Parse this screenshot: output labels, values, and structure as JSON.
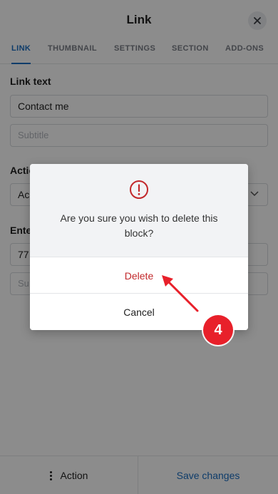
{
  "header": {
    "title": "Link"
  },
  "tabs": [
    {
      "label": "LINK"
    },
    {
      "label": "THUMBNAIL"
    },
    {
      "label": "SETTINGS"
    },
    {
      "label": "SECTION"
    },
    {
      "label": "ADD-ONS"
    }
  ],
  "form": {
    "link_text_label": "Link text",
    "link_text_value": "Contact me",
    "subtitle_placeholder": "Subtitle",
    "action_label": "Actio",
    "action_value": "Ac",
    "enter_label": "Ente",
    "enter_value": "77",
    "enter_sub_placeholder": "Su"
  },
  "dialog": {
    "message": "Are you sure you wish to delete this block?",
    "delete_label": "Delete",
    "cancel_label": "Cancel"
  },
  "annotation": {
    "step_number": "4"
  },
  "bottom_bar": {
    "action_label": "Action",
    "save_label": "Save changes"
  },
  "colors": {
    "accent": "#1b6ec2",
    "danger": "#c2282b",
    "annotation_red": "#e8202a"
  }
}
